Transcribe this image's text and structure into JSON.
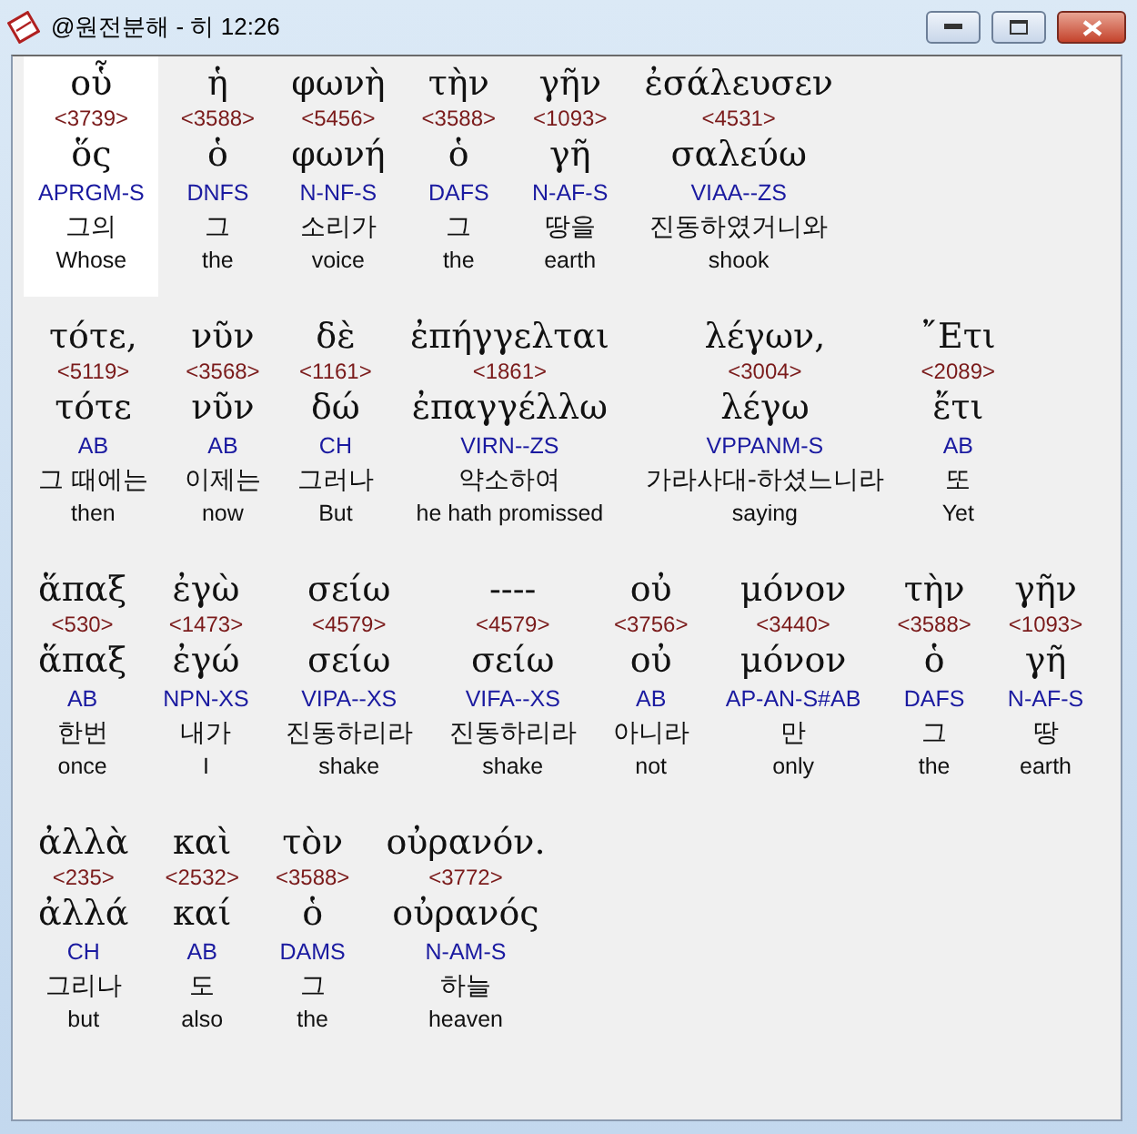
{
  "window": {
    "title": "@원전분해 - 히 12:26"
  },
  "lines": [
    {
      "words": [
        {
          "greek": "οὗ",
          "strong": "<3739>",
          "lemma": "ὅς",
          "parsing": "APRGM-S",
          "korean": "그의",
          "english": "Whose",
          "selected": true
        },
        {
          "greek": "ἡ",
          "strong": "<3588>",
          "lemma": "ὁ",
          "parsing": "DNFS",
          "korean": "그",
          "english": "the",
          "selected": false
        },
        {
          "greek": "φωνὴ",
          "strong": "<5456>",
          "lemma": "φωνή",
          "parsing": "N-NF-S",
          "korean": "소리가",
          "english": "voice",
          "selected": false
        },
        {
          "greek": "τὴν",
          "strong": "<3588>",
          "lemma": "ὁ",
          "parsing": "DAFS",
          "korean": "그",
          "english": "the",
          "selected": false
        },
        {
          "greek": "γῆν",
          "strong": "<1093>",
          "lemma": "γῆ",
          "parsing": "N-AF-S",
          "korean": "땅을",
          "english": "earth",
          "selected": false
        },
        {
          "greek": "ἐσάλευσεν",
          "strong": "<4531>",
          "lemma": "σαλεύω",
          "parsing": "VIAA--ZS",
          "korean": "진동하였거니와",
          "english": "shook",
          "selected": false
        }
      ]
    },
    {
      "words": [
        {
          "greek": "τότε,",
          "strong": "<5119>",
          "lemma": "τότε",
          "parsing": "AB",
          "korean": "그 때에는",
          "english": "then",
          "selected": false
        },
        {
          "greek": "νῦν",
          "strong": "<3568>",
          "lemma": "νῦν",
          "parsing": "AB",
          "korean": "이제는",
          "english": "now",
          "selected": false
        },
        {
          "greek": "δὲ",
          "strong": "<1161>",
          "lemma": "δώ",
          "parsing": "CH",
          "korean": "그러나",
          "english": "But",
          "selected": false
        },
        {
          "greek": "ἐπήγγελται",
          "strong": "<1861>",
          "lemma": "ἐπαγγέλλω",
          "parsing": "VIRN--ZS",
          "korean": "약소하여",
          "english": "he hath promissed",
          "selected": false
        },
        {
          "greek": "λέγων,",
          "strong": "<3004>",
          "lemma": "λέγω",
          "parsing": "VPPANM-S",
          "korean": "가라사대-하셨느니라",
          "english": "saying",
          "selected": false
        },
        {
          "greek": "῎Ετι",
          "strong": "<2089>",
          "lemma": "ἔτι",
          "parsing": "AB",
          "korean": "또",
          "english": "Yet",
          "selected": false
        }
      ]
    },
    {
      "words": [
        {
          "greek": "ἅπαξ",
          "strong": "<530>",
          "lemma": "ἅπαξ",
          "parsing": "AB",
          "korean": "한번",
          "english": "once",
          "selected": false
        },
        {
          "greek": "ἐγὼ",
          "strong": "<1473>",
          "lemma": "ἐγώ",
          "parsing": "NPN-XS",
          "korean": "내가",
          "english": "I",
          "selected": false
        },
        {
          "greek": "σείω",
          "strong": "<4579>",
          "lemma": "σείω",
          "parsing": "VIPA--XS",
          "korean": "진동하리라",
          "english": "shake",
          "selected": false
        },
        {
          "greek": "----",
          "strong": "<4579>",
          "lemma": "σείω",
          "parsing": "VIFA--XS",
          "korean": "진동하리라",
          "english": "shake",
          "selected": false
        },
        {
          "greek": "οὐ",
          "strong": "<3756>",
          "lemma": "οὐ",
          "parsing": "AB",
          "korean": "아니라",
          "english": "not",
          "selected": false
        },
        {
          "greek": "μόνον",
          "strong": "<3440>",
          "lemma": "μόνον",
          "parsing": "AP-AN-S#AB",
          "korean": "만",
          "english": "only",
          "selected": false
        },
        {
          "greek": "τὴν",
          "strong": "<3588>",
          "lemma": "ὁ",
          "parsing": "DAFS",
          "korean": "그",
          "english": "the",
          "selected": false
        },
        {
          "greek": "γῆν",
          "strong": "<1093>",
          "lemma": "γῆ",
          "parsing": "N-AF-S",
          "korean": "땅",
          "english": "earth",
          "selected": false
        }
      ]
    },
    {
      "words": [
        {
          "greek": "ἀλλὰ",
          "strong": "<235>",
          "lemma": "ἀλλά",
          "parsing": "CH",
          "korean": "그리나",
          "english": "but",
          "selected": false
        },
        {
          "greek": "καὶ",
          "strong": "<2532>",
          "lemma": "καί",
          "parsing": "AB",
          "korean": "도",
          "english": "also",
          "selected": false
        },
        {
          "greek": "τὸν",
          "strong": "<3588>",
          "lemma": "ὁ",
          "parsing": "DAMS",
          "korean": "그",
          "english": "the",
          "selected": false
        },
        {
          "greek": "οὐρανόν.",
          "strong": "<3772>",
          "lemma": "οὐρανός",
          "parsing": "N-AM-S",
          "korean": "하늘",
          "english": "heaven",
          "selected": false
        }
      ]
    }
  ]
}
